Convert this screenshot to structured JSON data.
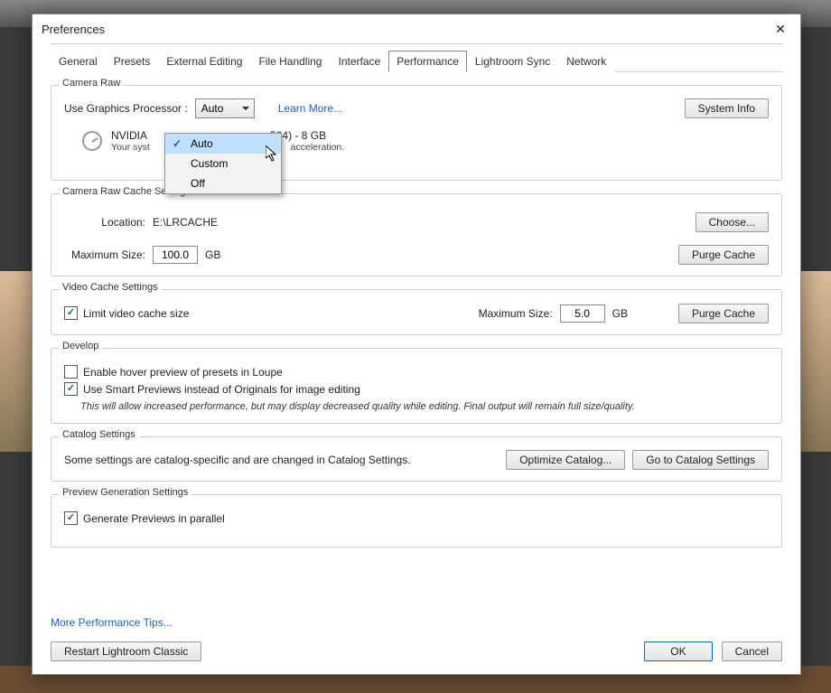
{
  "title": "Preferences",
  "tabs": [
    "General",
    "Presets",
    "External Editing",
    "File Handling",
    "Interface",
    "Performance",
    "Lightroom Sync",
    "Network"
  ],
  "active_tab": "Performance",
  "camera_raw": {
    "title": "Camera Raw",
    "gpu_label": "Use Graphics Processor :",
    "gpu_value": "Auto",
    "learn_more": "Learn More...",
    "system_info": "System Info",
    "gpu_name_fragment_left": "NVIDIA",
    "gpu_name_fragment_right": "584) - 8 GB",
    "gpu_sub_left": "Your syst",
    "gpu_sub_right": "acceleration.",
    "dropdown_options": [
      "Auto",
      "Custom",
      "Off"
    ],
    "dropdown_selected": "Auto"
  },
  "cache": {
    "title": "Camera Raw Cache Settings",
    "location_label": "Location:",
    "location_value": "E:\\LRCACHE",
    "choose": "Choose...",
    "max_label": "Maximum Size:",
    "max_value": "100.0",
    "unit": "GB",
    "purge": "Purge Cache"
  },
  "video": {
    "title": "Video Cache Settings",
    "limit_label": "Limit video cache size",
    "limit_checked": true,
    "max_label": "Maximum Size:",
    "max_value": "5.0",
    "unit": "GB",
    "purge": "Purge Cache"
  },
  "develop": {
    "title": "Develop",
    "hover_label": "Enable hover preview of presets in Loupe",
    "hover_checked": false,
    "smart_label": "Use Smart Previews instead of Originals for image editing",
    "smart_checked": true,
    "note": "This will allow increased performance, but may display decreased quality while editing. Final output will remain full size/quality."
  },
  "catalog": {
    "title": "Catalog Settings",
    "text": "Some settings are catalog-specific and are changed in Catalog Settings.",
    "optimize": "Optimize Catalog...",
    "goto": "Go to Catalog Settings"
  },
  "preview": {
    "title": "Preview Generation Settings",
    "gen_label": "Generate Previews in parallel",
    "gen_checked": true
  },
  "more_tips": "More Performance Tips...",
  "footer": {
    "restart": "Restart Lightroom Classic",
    "ok": "OK",
    "cancel": "Cancel"
  }
}
